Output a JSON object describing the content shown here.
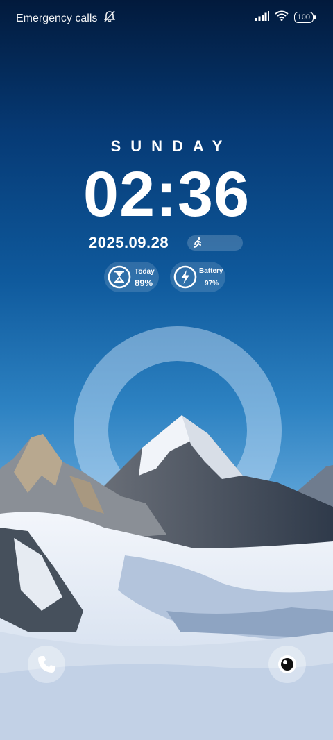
{
  "status_bar": {
    "carrier_text": "Emergency calls",
    "battery_level": "100",
    "icons": [
      "mute-icon",
      "signal-icon",
      "wifi-icon",
      "battery-icon"
    ]
  },
  "lockscreen": {
    "day": "SUNDAY",
    "time": "02:36",
    "date": "2025.09.28",
    "steps_progress": 0.0
  },
  "widgets": {
    "today": {
      "label": "Today",
      "value": "89%",
      "icon": "hourglass-icon"
    },
    "battery": {
      "label": "Battery",
      "value": "97%",
      "icon": "lightning-icon"
    }
  },
  "shortcuts": {
    "left": {
      "icon": "phone-icon"
    },
    "right": {
      "icon": "camera-icon"
    }
  },
  "colors": {
    "sky_top": "#021a3c",
    "sky_mid": "#0f5a9d",
    "sky_bottom": "#8cbde6",
    "snow": "#e8eff8"
  }
}
